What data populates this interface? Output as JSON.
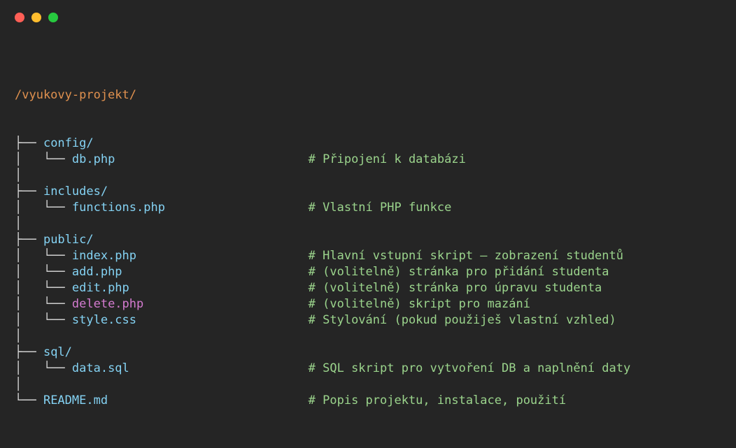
{
  "window": {
    "controls": {
      "close_color": "#ff5f56",
      "minimize_color": "#ffbd2e",
      "maximize_color": "#27c93f"
    }
  },
  "tree": {
    "root": "/vyukovy-projekt/",
    "lines": [
      {
        "prefix": "├── ",
        "name": "config/",
        "kind": "dir",
        "comment": ""
      },
      {
        "prefix": "│   └── ",
        "name": "db.php",
        "kind": "file",
        "comment": "# Připojení k databázi"
      },
      {
        "prefix": "│",
        "name": "",
        "kind": "blank",
        "comment": ""
      },
      {
        "prefix": "├── ",
        "name": "includes/",
        "kind": "dir",
        "comment": ""
      },
      {
        "prefix": "│   └── ",
        "name": "functions.php",
        "kind": "file",
        "comment": "# Vlastní PHP funkce"
      },
      {
        "prefix": "│",
        "name": "",
        "kind": "blank",
        "comment": ""
      },
      {
        "prefix": "├── ",
        "name": "public/",
        "kind": "dir",
        "comment": ""
      },
      {
        "prefix": "│   └── ",
        "name": "index.php",
        "kind": "file",
        "comment": "# Hlavní vstupní skript – zobrazení studentů"
      },
      {
        "prefix": "│   └── ",
        "name": "add.php",
        "kind": "file",
        "comment": "# (volitelně) stránka pro přidání studenta"
      },
      {
        "prefix": "│   └── ",
        "name": "edit.php",
        "kind": "file",
        "comment": "# (volitelně) stránka pro úpravu studenta"
      },
      {
        "prefix": "│   └── ",
        "name": "delete.php",
        "kind": "file-del",
        "comment": "# (volitelně) skript pro mazání"
      },
      {
        "prefix": "│   └── ",
        "name": "style.css",
        "kind": "file",
        "comment": "# Stylování (pokud použiješ vlastní vzhled)"
      },
      {
        "prefix": "│",
        "name": "",
        "kind": "blank",
        "comment": ""
      },
      {
        "prefix": "├── ",
        "name": "sql/",
        "kind": "dir",
        "comment": ""
      },
      {
        "prefix": "│   └── ",
        "name": "data.sql",
        "kind": "file",
        "comment": "# SQL skript pro vytvoření DB a naplnění daty"
      },
      {
        "prefix": "│",
        "name": "",
        "kind": "blank",
        "comment": ""
      },
      {
        "prefix": "└── ",
        "name": "README.md",
        "kind": "file",
        "comment": "# Popis projektu, instalace, použití"
      }
    ]
  }
}
